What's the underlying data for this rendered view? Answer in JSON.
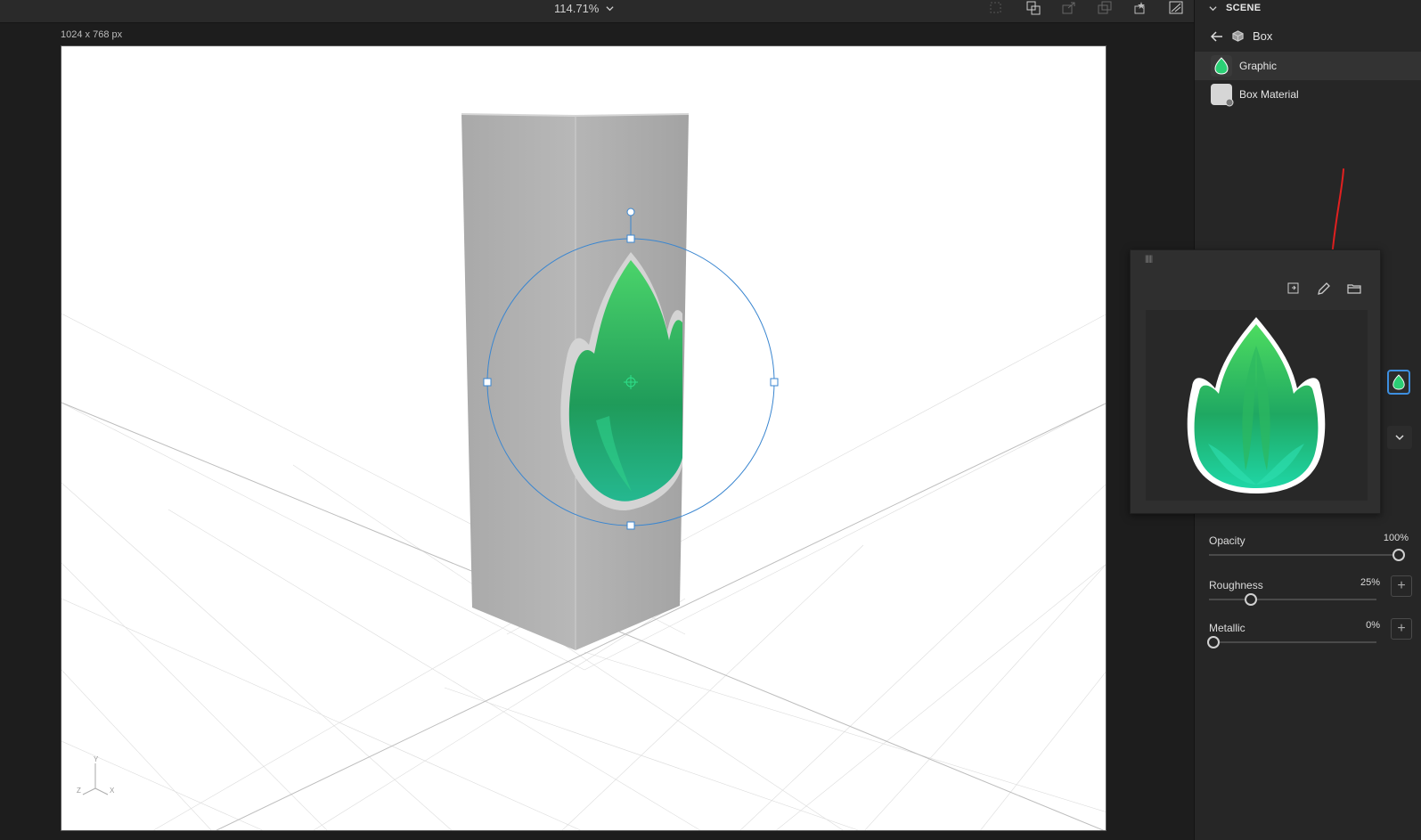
{
  "toolbar": {
    "zoom_value": "114.71%",
    "icons": [
      "grid-icon",
      "transform-icon",
      "export-icon",
      "share-icon",
      "magic-icon",
      "render-icon"
    ]
  },
  "canvas": {
    "doc_size": "1024 x 768 px",
    "axes": {
      "y": "Y",
      "z": "Z",
      "x": "X"
    }
  },
  "scene_panel": {
    "header": "SCENE",
    "breadcrumb": "Box",
    "layers": [
      {
        "label": "Graphic",
        "selected": true
      },
      {
        "label": "Box Material",
        "selected": false
      }
    ]
  },
  "properties": {
    "opacity": {
      "label": "Opacity",
      "value": "100%",
      "level": 1.0
    },
    "roughness": {
      "label": "Roughness",
      "value": "25%",
      "level": 0.25
    },
    "metallic": {
      "label": "Metallic",
      "value": "0%",
      "level": 0.0
    }
  },
  "colors": {
    "accent": "#3d8fe0",
    "annotation": "#e02020",
    "flame_light": "#3ddc84",
    "flame_dark": "#1a9a5a"
  }
}
